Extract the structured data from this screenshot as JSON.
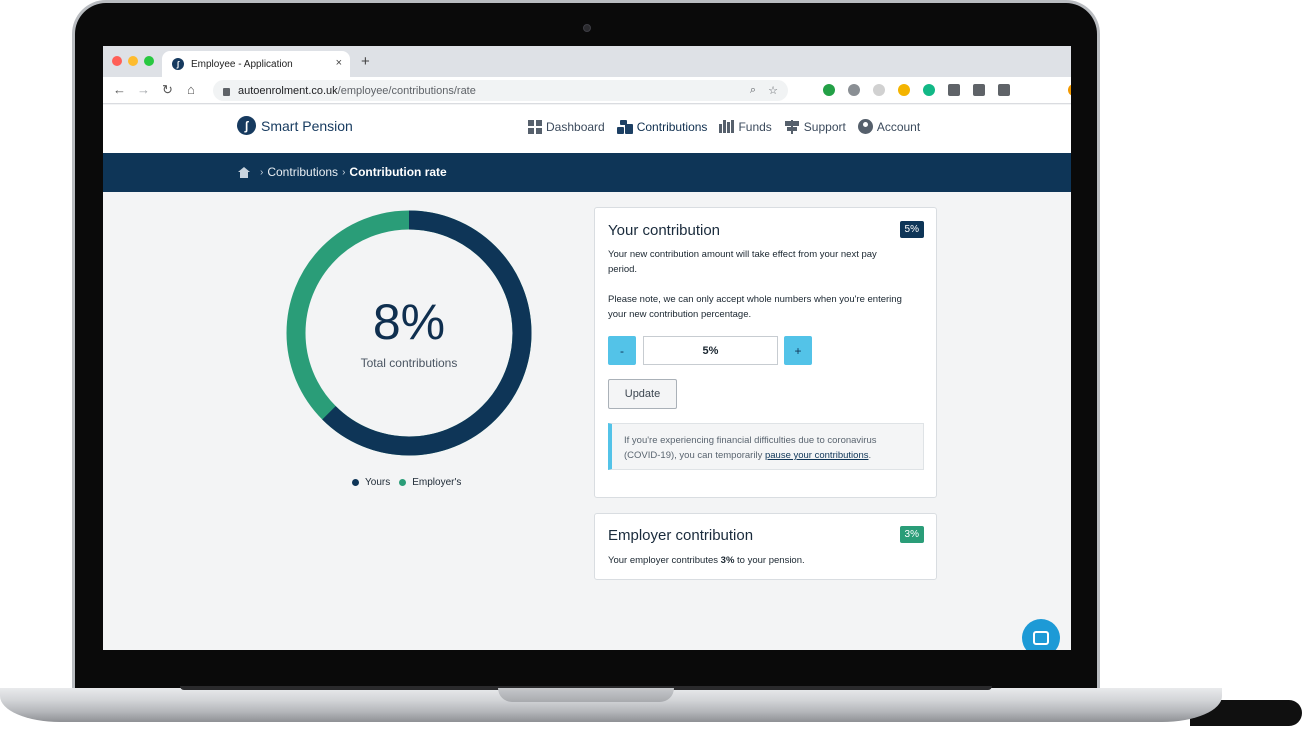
{
  "browser": {
    "tab_title": "Employee - Application",
    "tab_close": "×",
    "new_tab": "+",
    "url_host": "autoenrolment.co.uk",
    "url_path": "/employee/contributions/rate",
    "back": "←",
    "forward": "→",
    "reload": "↻",
    "home": "⌂",
    "search": "⌕",
    "star": "☆",
    "extension_colors": [
      "#23a046",
      "#8a8f94",
      "#d1d1d1",
      "#f4b400",
      "#12b886",
      "#5f6368",
      "#5f6368",
      "#5f6368",
      "#f29900"
    ]
  },
  "header": {
    "logo_mark": "ʃ",
    "brand": "Smart Pension",
    "nav": [
      {
        "label": "Dashboard",
        "icon": "grid-icon"
      },
      {
        "label": "Contributions",
        "icon": "coins-icon",
        "active": true
      },
      {
        "label": "Funds",
        "icon": "bar-chart-icon"
      },
      {
        "label": "Support",
        "icon": "signpost-icon"
      },
      {
        "label": "Account",
        "icon": "user-icon"
      }
    ]
  },
  "breadcrumb": {
    "sep": "›",
    "parent": "Contributions",
    "current": "Contribution rate"
  },
  "total": {
    "value": "8%",
    "label": "Total contributions",
    "yours_percent": 5,
    "employer_percent": 3
  },
  "legend": {
    "yours": "Yours",
    "employers": "Employer's"
  },
  "colors": {
    "navy": "#0e3557",
    "green": "#2a9d78",
    "cyan": "#53c3e8"
  },
  "your_contribution": {
    "title": "Your contribution",
    "badge": "5%",
    "text1": "Your new contribution amount will take effect from your next pay period.",
    "text2": "Please note, we can only accept whole numbers when you're entering your new contribution percentage.",
    "decrement": "-",
    "increment": "+",
    "input_value": "5%",
    "update_label": "Update",
    "notice_text": "If you're experiencing financial difficulties due to coronavirus (COVID-19), you can temporarily ",
    "notice_link": "pause your contributions",
    "notice_end": "."
  },
  "employer_contribution": {
    "title": "Employer contribution",
    "badge": "3%",
    "text_pre": "Your employer contributes ",
    "text_value": "3%",
    "text_post": " to your pension."
  }
}
